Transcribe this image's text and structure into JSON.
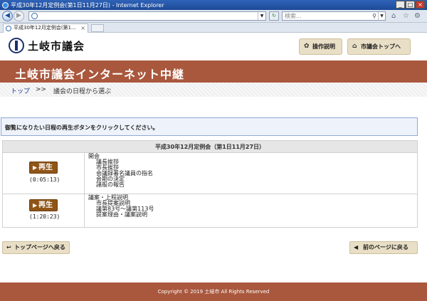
{
  "window": {
    "title": "平成30年12月定例会(第1日11月27日) - Internet Explorer"
  },
  "browser": {
    "search_placeholder": "検索...",
    "tab_title": "平成30年12月定例会(第1...",
    "icons": [
      "back-icon",
      "forward-icon",
      "search-icon",
      "home-icon",
      "star-icon",
      "gear-icon"
    ]
  },
  "site": {
    "logo": "土岐市議会",
    "header_buttons": {
      "operation": "操作説明",
      "council_top": "市議会トップへ"
    },
    "banner_title": "土岐市議会インターネット中継",
    "breadcrumb": {
      "home": "トップ",
      "sep": ">>",
      "current": "議会の日程から選ぶ"
    },
    "notice": "御覧になりたい日程の再生ボタンをクリックしてください。",
    "schedule": {
      "heading": "平成30年12月定例会（第1日11月27日）",
      "rows": [
        {
          "play_label": "再生",
          "duration": "(0:05:13)",
          "items": [
            "開会",
            "議長挨拶",
            "市長挨拶",
            "会議録署名議員の指名",
            "会期の決定",
            "諸般の報告"
          ]
        },
        {
          "play_label": "再生",
          "duration": "(1:20:23)",
          "items": [
            "議案・上程説明",
            "市長提案説明",
            "議第83号～議第113号",
            "提案理由・議案説明"
          ]
        }
      ]
    },
    "footer_buttons": {
      "to_top": "トップページへ戻る",
      "prev": "前のページに戻る"
    },
    "copyright": "Copyright © 2019 土岐市 All Rights Reserved"
  },
  "colors": {
    "accent": "#a9583e",
    "play": "#8f5518",
    "button_bg": "#e9dfc6"
  }
}
